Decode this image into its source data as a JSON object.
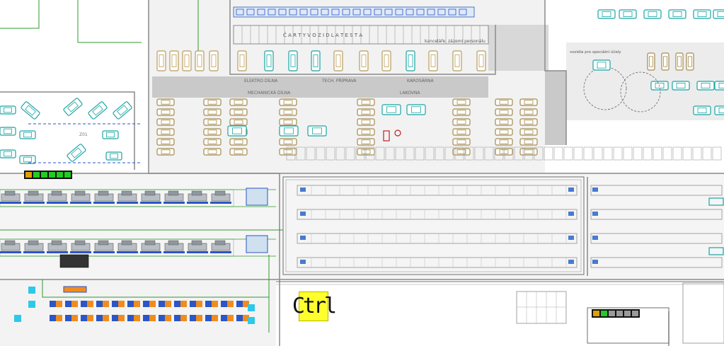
{
  "app": {
    "title": ""
  },
  "ctrl_badge": {
    "label": "Ctrl"
  },
  "zone_labels": {
    "top_hall_label": "Č A R T Y  V O Z I D L A  T E S T A",
    "electro_label": "ELEKTRO DÍLNA",
    "tech_label": "TECH. PŘÍPRAVA",
    "bodywork_label": "KAROSÁRNA",
    "mechanics_label": "MECHANICKÁ DÍLNA",
    "lacquer_label": "LAKOVNA",
    "office_label": "kanceláře, zázemí personálu",
    "side_label": "vozidla pro speciální účely",
    "zone_tag": "Z01"
  },
  "colors": {
    "signal_green": "#22cc22",
    "signal_amber": "#e0a000",
    "vehicle_teal": "#1aa3a3",
    "conveyor_blue": "#2a56c8",
    "marker_orange": "#f08c1e",
    "marker_cyan": "#2ec8e8",
    "ctrl_yellow": "#ffff2e",
    "pipe_green": "#2f9a2f",
    "wall_gray": "#8a8a8a"
  },
  "signals": [
    {
      "name": "signal-bar-top",
      "states": [
        "amber",
        "green",
        "green",
        "green",
        "green",
        "green"
      ]
    },
    {
      "name": "signal-bar-bottom",
      "states": [
        "amber",
        "green",
        "gray",
        "gray",
        "gray",
        "gray"
      ]
    }
  ],
  "icons": [
    "car-icon",
    "conveyor-icon",
    "signal-light-icon",
    "crossing-icon"
  ]
}
